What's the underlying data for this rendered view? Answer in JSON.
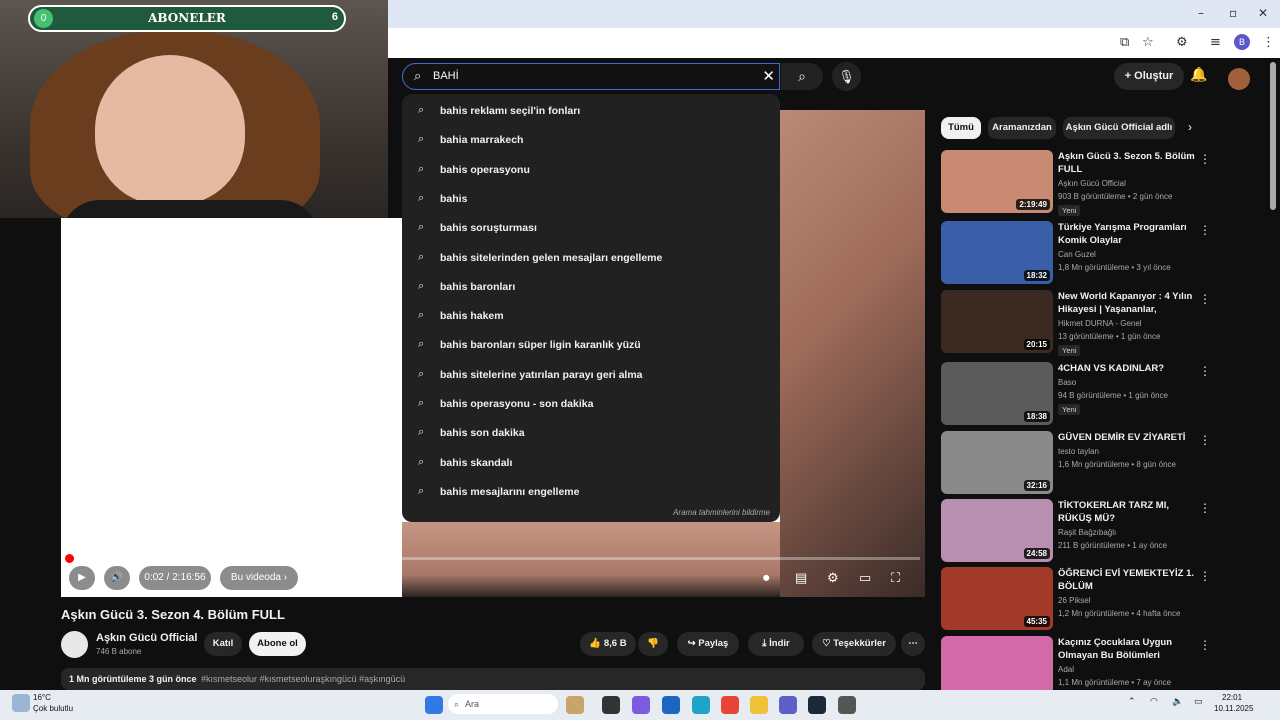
{
  "overlay": {
    "subs_label": "ABONELER",
    "subs_left": "0",
    "subs_right": "6"
  },
  "search": {
    "query": "BAHİ",
    "report_link": "Arama tahminlerini bildirme"
  },
  "suggestions": [
    "bahis reklamı seçil'in fonları",
    "bahia marrakech",
    "bahis operasyonu",
    "bahis",
    "bahis soruşturması",
    "bahis sitelerinden gelen mesajları engelleme",
    "bahis baronları",
    "bahis hakem",
    "bahis baronları süper ligin karanlık yüzü",
    "bahis sitelerine yatırılan parayı geri alma",
    "bahis operasyonu - son dakika",
    "bahis son dakika",
    "bahis skandalı",
    "bahis mesajlarını engelleme"
  ],
  "header": {
    "create_label": "Oluştur"
  },
  "player": {
    "time": "0:02 / 2:16:56",
    "chapter": "Bu videoda"
  },
  "video": {
    "title": "Aşkın Gücü 3. Sezon 4. Bölüm FULL",
    "channel": "Aşkın Gücü Official",
    "subs": "746 B abone",
    "join": "Katıl",
    "subscribe": "Abone ol",
    "likes": "8,6 B",
    "share": "Paylaş",
    "download": "İndir",
    "thanks": "Teşekkürler",
    "views_date": "1 Mn görüntüleme  3 gün önce",
    "hashtags": "#kısmetseolur #kısmetseoluraşkıngücü #aşkıngücü"
  },
  "chips": [
    "Tümü",
    "Aramanızdan",
    "Aşkın Gücü Official adlı"
  ],
  "recommended": [
    {
      "title": "Aşkın Gücü 3. Sezon 5. Bölüm FULL",
      "channel": "Aşkın Gücü Official",
      "meta": "903 B görüntüleme • 2 gün önce",
      "badge": "Yeni",
      "duration": "2:19:49",
      "color": "#c98a73"
    },
    {
      "title": "Türkiye Yarışma Programları Komik Olaylar",
      "channel": "Can Guzel",
      "meta": "1,8 Mn görüntüleme • 3 yıl önce",
      "badge": "",
      "duration": "18:32",
      "color": "#3a5fa8"
    },
    {
      "title": "New World Kapanıyor : 4 Yılın Hikayesi | Yaşananlar, Tepkiler,...",
      "channel": "Hikmet DURNA - Genel",
      "meta": "13 görüntüleme • 1 gün önce",
      "badge": "Yeni",
      "duration": "20:15",
      "color": "#3b2a22"
    },
    {
      "title": "4CHAN VS KADINLAR?",
      "channel": "Baso",
      "meta": "94 B görüntüleme • 1 gün önce",
      "badge": "Yeni",
      "duration": "18:38",
      "color": "#5a5a5a"
    },
    {
      "title": "GÜVEN DEMİR EV ZİYARETİ",
      "channel": "testo taylan",
      "meta": "1,6 Mn görüntüleme • 8 gün önce",
      "badge": "",
      "duration": "32:16",
      "color": "#8a8a8a"
    },
    {
      "title": "TİKTOKERLAR TARZ MI, RÜKÜŞ MÜ?",
      "channel": "Raşit Bağzıbağlı",
      "meta": "211 B görüntüleme • 1 ay önce",
      "badge": "",
      "duration": "24:58",
      "color": "#b98fb0"
    },
    {
      "title": "ÖĞRENCİ EVİ YEMEKTEYİZ 1. BÖLÜM",
      "channel": "26 Piksel",
      "meta": "1,2 Mn görüntüleme • 4 hafta önce",
      "badge": "",
      "duration": "45:35",
      "color": "#a23a2a"
    },
    {
      "title": "Kaçınız Çocuklara Uygun Olmayan Bu Bölümleri Farketti...",
      "channel": "Adal",
      "meta": "1,1 Mn görüntüleme • 7 ay önce",
      "badge": "",
      "duration": "",
      "color": "#d26aa8"
    }
  ],
  "taskbar": {
    "temp": "16°C",
    "weather": "Çok bulutlu",
    "search_placeholder": "Ara",
    "time": "22:01",
    "date": "10.11.2025"
  }
}
